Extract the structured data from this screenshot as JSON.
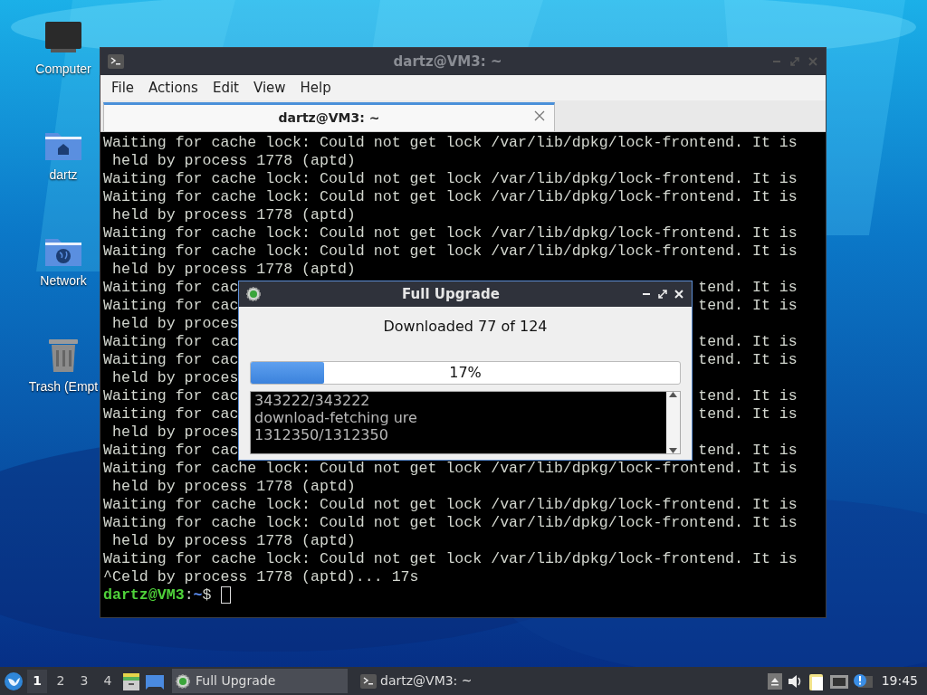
{
  "desktop_icons": [
    {
      "label": "Computer",
      "kind": "computer"
    },
    {
      "label": "dartz",
      "kind": "home"
    },
    {
      "label": "Network",
      "kind": "network"
    },
    {
      "label": "Trash (Empt",
      "kind": "trash"
    }
  ],
  "terminal_window": {
    "title": "dartz@VM3: ~",
    "menu": [
      "File",
      "Actions",
      "Edit",
      "View",
      "Help"
    ],
    "tabs": [
      {
        "label": "dartz@VM3: ~",
        "selected": true
      }
    ],
    "lines": [
      {
        "text": "Waiting for cache lock: Could not get lock /var/lib/dpkg/lock-frontend. It is"
      },
      {
        "text": " held by process 1778 (aptd)"
      },
      {
        "text": "Waiting for cache lock: Could not get lock /var/lib/dpkg/lock-frontend. It is"
      },
      {
        "text": "Waiting for cache lock: Could not get lock /var/lib/dpkg/lock-frontend. It is"
      },
      {
        "text": " held by process 1778 (aptd)"
      },
      {
        "text": "Waiting for cache lock: Could not get lock /var/lib/dpkg/lock-frontend. It is"
      },
      {
        "text": "Waiting for cache lock: Could not get lock /var/lib/dpkg/lock-frontend. It is"
      },
      {
        "text": " held by process 1778 (aptd)"
      },
      {
        "text": "Waiting for cac",
        "tail": "tend. It is"
      },
      {
        "text": "Waiting for cac",
        "tail": "tend. It is"
      },
      {
        "text": " held by proces"
      },
      {
        "text": "Waiting for cac",
        "tail": "tend. It is"
      },
      {
        "text": "Waiting for cac",
        "tail": "tend. It is"
      },
      {
        "text": " held by proces"
      },
      {
        "text": "Waiting for cac",
        "tail": "tend. It is"
      },
      {
        "text": "Waiting for cac",
        "tail": "tend. It is"
      },
      {
        "text": " held by proces"
      },
      {
        "text": "Waiting for cac",
        "tail": "tend. It is"
      },
      {
        "text": "Waiting for cache lock: Could not get lock /var/lib/dpkg/lock-frontend. It is"
      },
      {
        "text": " held by process 1778 (aptd)"
      },
      {
        "text": "Waiting for cache lock: Could not get lock /var/lib/dpkg/lock-frontend. It is"
      },
      {
        "text": "Waiting for cache lock: Could not get lock /var/lib/dpkg/lock-frontend. It is"
      },
      {
        "text": " held by process 1778 (aptd)"
      },
      {
        "text": "Waiting for cache lock: Could not get lock /var/lib/dpkg/lock-frontend. It is"
      },
      {
        "text": "^Celd by process 1778 (aptd)... 17s"
      }
    ],
    "prompt": {
      "user_host": "dartz@VM3",
      "separator": ":",
      "path": "~",
      "symbol": "$"
    }
  },
  "dialog": {
    "title": "Full Upgrade",
    "status": "Downloaded 77 of 124",
    "progress": {
      "level": 0.17,
      "label": "17%"
    },
    "log": [
      "343222/343222",
      "download-fetching ure",
      "1312350/1312350"
    ]
  },
  "taskbar": {
    "workspaces": [
      {
        "label": "1",
        "selected": true
      },
      {
        "label": "2",
        "selected": false
      },
      {
        "label": "3",
        "selected": false
      },
      {
        "label": "4",
        "selected": false
      }
    ],
    "tasks": [
      {
        "label": "Full Upgrade",
        "selected": true,
        "kind": "upgrade"
      },
      {
        "label": "dartz@VM3: ~",
        "selected": false,
        "kind": "terminal"
      }
    ],
    "clock": "19:45"
  }
}
